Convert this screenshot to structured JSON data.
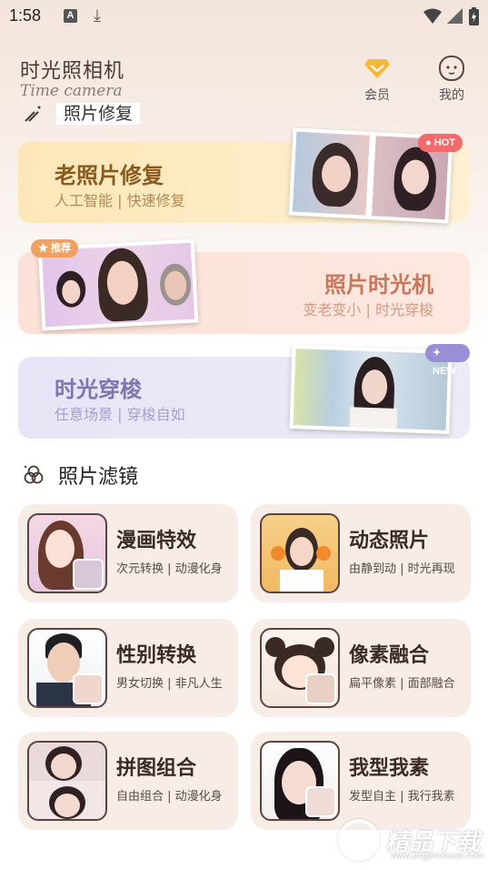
{
  "status_bar": {
    "time": "1:58",
    "notif_letter": "A"
  },
  "header": {
    "title": "时光照相机",
    "subtitle": "Time camera",
    "member_label": "会员",
    "mine_label": "我的"
  },
  "section_peek": {
    "label": "照片修复"
  },
  "banners": [
    {
      "title": "老照片修复",
      "subtitle": "人工智能 | 快速修复",
      "badge": "HOT"
    },
    {
      "title": "照片时光机",
      "subtitle": "变老变小 | 时光穿梭",
      "badge": "推荐"
    },
    {
      "title": "时光穿梭",
      "subtitle": "任意场景 | 穿梭自如",
      "badge": "NEW"
    }
  ],
  "filters": {
    "heading": "照片滤镜",
    "items": [
      {
        "title": "漫画特效",
        "subtitle": "次元转换 | 动漫化身"
      },
      {
        "title": "动态照片",
        "subtitle": "由静到动 | 时光再现"
      },
      {
        "title": "性别转换",
        "subtitle": "男女切换 | 非凡人生"
      },
      {
        "title": "像素融合",
        "subtitle": "扁平像素 | 面部融合"
      },
      {
        "title": "拼图组合",
        "subtitle": "自由组合 | 动漫化身"
      },
      {
        "title": "我型我素",
        "subtitle": "发型自主 | 我行我素"
      }
    ]
  },
  "watermark": {
    "text": "精品下载",
    "url": "www.jingpinxiazai.com"
  },
  "colors": {
    "banner1_title": "#8a5a1e",
    "banner1_sub": "#b08a54",
    "banner2_title": "#c8785c",
    "banner2_sub": "#d49a86",
    "banner3_title": "#7f76b0",
    "banner3_sub": "#a6a0cc",
    "hot_badge": "#f26a6a",
    "recommend_badge": "#f0a060",
    "new_badge": "#9a8fd6"
  }
}
